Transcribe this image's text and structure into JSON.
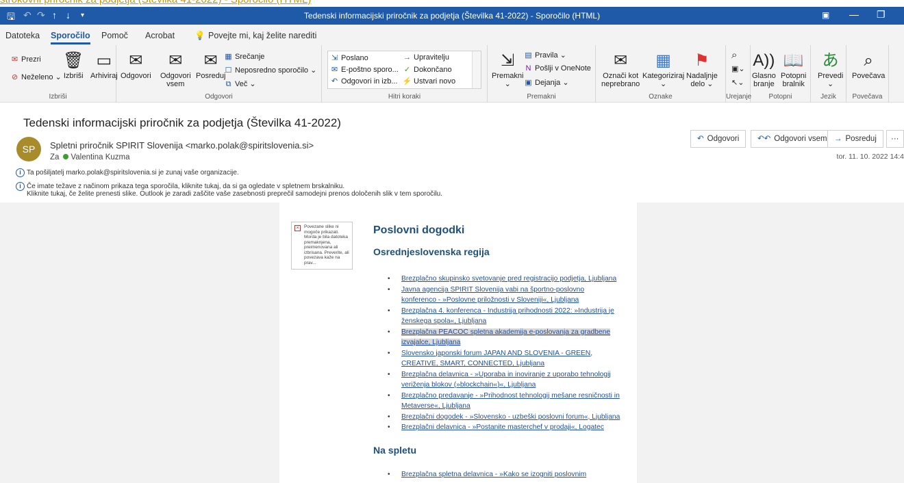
{
  "top_strip": "strokovni priročnik za podjetja (Številka 41-2022) - Sporočilo (HTML)",
  "titlebar": {
    "title": "Tedenski informacijski priročnik za podjetja (Številka 41-2022)  -  Sporočilo (HTML)"
  },
  "menu": {
    "tabs": [
      "Datoteka",
      "Sporočilo",
      "Pomoč",
      "Acrobat"
    ],
    "active": "Sporočilo",
    "tell_me": "Povejte mi, kaj želite narediti"
  },
  "ribbon": {
    "delete_group": {
      "ignore": "Prezri",
      "junk": "Neželeno",
      "delete": "Izbriši",
      "archive": "Arhiviraj",
      "label": "Izbriši"
    },
    "respond_group": {
      "reply": "Odgovori",
      "reply_all_1": "Odgovori",
      "reply_all_2": "vsem",
      "forward": "Posreduj",
      "meeting": "Srečanje",
      "im": "Neposredno sporočilo",
      "more": "Več",
      "label": "Odgovori"
    },
    "quick_steps": {
      "items": [
        "Poslano",
        "E-poštno sporo...",
        "Odgovori in izb...",
        "Upravitelju",
        "Dokončano",
        "Ustvari novo"
      ],
      "label": "Hitri koraki"
    },
    "move_group": {
      "move": "Premakni",
      "rules": "Pravila",
      "onenote": "Pošlji v OneNote",
      "actions": "Dejanja",
      "label": "Premakni"
    },
    "tags_group": {
      "unread_1": "Označi kot",
      "unread_2": "neprebrano",
      "categorize": "Kategoriziraj",
      "followup_1": "Nadaljnje",
      "followup_2": "delo",
      "label": "Oznake"
    },
    "editing_label": "Urejanje",
    "speech_group": {
      "read_1": "Glasno",
      "read_2": "branje",
      "reader_1": "Potopni",
      "reader_2": "bralnik",
      "label": "Potopni"
    },
    "language_group": {
      "translate": "Prevedi",
      "label": "Jezik"
    },
    "zoom_group": {
      "zoom": "Povečava",
      "label": "Povečava"
    }
  },
  "message": {
    "subject": "Tedenski informacijski priročnik za podjetja (Številka 41-2022)",
    "avatar_initials": "SP",
    "sender": "Spletni priročnik SPIRIT Slovenija <marko.polak@spiritslovenia.si>",
    "to_label": "Za",
    "recipient": "Valentina Kuzma",
    "info1": "Ta pošiljatelj marko.polak@spiritslovenia.si je zunaj vaše organizacije.",
    "info2": "Če imate težave z načinom prikaza tega sporočila, kliknite tukaj, da si ga ogledate v spletnem brskalniku.",
    "info3": "Kliknite tukaj, če želite prenesti slike. Outlook je zaradi zaščite vaše zasebnosti preprečil samodejni prenos določenih slik v tem sporočilu.",
    "actions": {
      "reply": "Odgovori",
      "reply_all": "Odgovori vsem",
      "forward": "Posreduj"
    },
    "date": "tor. 11. 10. 2022 14:4"
  },
  "body": {
    "image_placeholder": "Povezane slike ni mogoče prikazati. Morda je bila datoteka premaknjena, preimenovana ali izbrisana. Preverite, ali povezava kaže na prav...",
    "heading": "Poslovni dogodki",
    "region": "Osrednjeslovenska regija",
    "links": [
      [
        "Brezplačno skupinsko svetovanje pred registracijo podjetja, Ljubljana"
      ],
      [
        "Javna agencija SPIRIT Slovenija vabi na športno-poslovno",
        "konferenco - »Poslovne priložnosti v Sloveniji«, Ljubljana"
      ],
      [
        "Brezplačna 4. konferenca - Industrija prihodnosti 2022: »Industrija je",
        "ženskega spola«, Ljubljana"
      ],
      [
        "Brezplačna PEACOC spletna akademija e-poslovanja za gradbene",
        "izvajalce, Ljubljana"
      ],
      [
        "Slovensko japonski forum JAPAN AND SLOVENIA - GREEN,",
        "CREATIVE, SMART, CONNECTED, Ljubljana"
      ],
      [
        "Brezplačna delavnica - »Uporaba in inoviranje z uporabo tehnologij",
        "veriženja blokov (»blockchain«)«, Ljubljana"
      ],
      [
        "Brezplačno predavanje - »Prihodnost tehnologij mešane resničnosti in",
        "Metaverse«, Ljubljana"
      ],
      [
        "Brezplačni dogodek - »Slovensko - uzbeški poslovni forum«, Ljubljana"
      ],
      [
        "Brezplačni delavnica - »Postanite masterchef v prodaji«, Logatec"
      ]
    ],
    "selected_index": 3,
    "online_heading": "Na spletu",
    "online_links": [
      [
        "Brezplačna spletna delavnica - »Kako se izogniti poslovnim"
      ]
    ]
  }
}
